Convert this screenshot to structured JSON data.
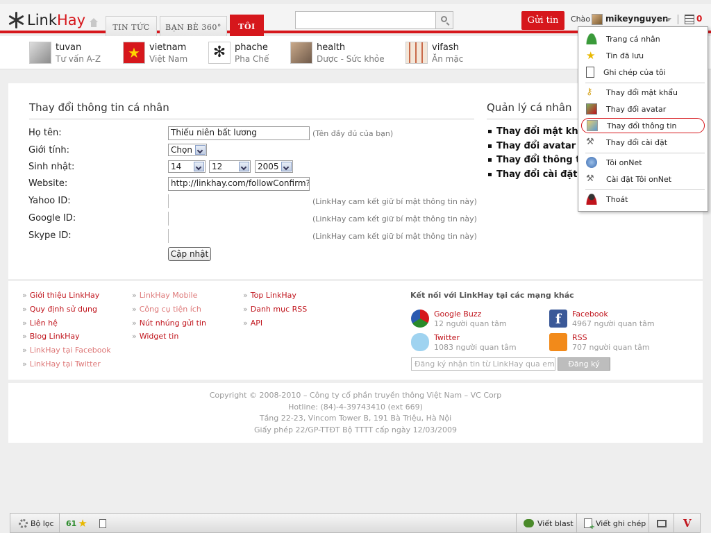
{
  "header": {
    "logo_a": "Link",
    "logo_b": "Hay",
    "tabs": [
      {
        "label": "TIN TỨC"
      },
      {
        "label": "BẠN BÈ 360°"
      },
      {
        "label": "TÔI"
      }
    ],
    "search_placeholder": "",
    "post_button": "Gửi tin",
    "greeting": "Chào",
    "username": "mikeynguyen",
    "notification_count": "0",
    "accent_color": "#d6171c"
  },
  "categories": [
    {
      "name": "tuvan",
      "sub": "Tư vấn A-Z"
    },
    {
      "name": "vietnam",
      "sub": "Việt Nam"
    },
    {
      "name": "phache",
      "sub": "Pha Chế"
    },
    {
      "name": "health",
      "sub": "Dược - Sức khỏe"
    },
    {
      "name": "vifash",
      "sub": "Ăn mặc"
    }
  ],
  "form": {
    "title": "Thay đổi thông tin cá nhân",
    "fields": {
      "name_label": "Họ tên:",
      "name_value": "Thiếu niên bất lương",
      "name_hint": "(Tên đầy đủ của bạn)",
      "gender_label": "Giới tính:",
      "gender_value": "Chọn",
      "birthday_label": "Sinh nhật:",
      "birthday_day": "14",
      "birthday_month": "12",
      "birthday_year": "2005",
      "website_label": "Website:",
      "website_value": "http://linkhay.com/followConfirm?u",
      "yahoo_label": "Yahoo ID:",
      "google_label": "Google ID:",
      "skype_label": "Skype ID:",
      "privacy_hint": "(LinkHay cam kết giữ bí mật thông tin này)"
    },
    "update_button": "Cập nhật"
  },
  "side": {
    "title": "Quản lý cá nhân",
    "links": [
      "Thay đổi mật khẩu",
      "Thay đổi avatar",
      "Thay đổi thông tin",
      "Thay đổi cài đặt"
    ]
  },
  "footer": {
    "col1": [
      "Giới thiệu LinkHay",
      "Quy định sử dụng",
      "Liên hệ",
      "Blog LinkHay",
      "LinkHay tại Facebook",
      "LinkHay tại Twitter"
    ],
    "col2": [
      "LinkHay Mobile",
      "Công cụ tiện ích",
      "Nút nhúng gửi tin",
      "Widget tin"
    ],
    "col3": [
      "Top LinkHay",
      "Danh mục RSS",
      "API"
    ],
    "connect_title": "Kết nối với LinkHay tại các mạng khác",
    "socials": [
      {
        "name": "Google Buzz",
        "count": "12 người quan tâm"
      },
      {
        "name": "Facebook",
        "count": "4967 người quan tâm"
      },
      {
        "name": "Twitter",
        "count": "1083 người quan tâm"
      },
      {
        "name": "RSS",
        "count": "707 người quan tâm"
      }
    ],
    "subscribe_placeholder": "Đăng ký nhận tin từ LinkHay qua email",
    "subscribe_button": "Đăng ký"
  },
  "copyright": [
    "Copyright © 2008-2010 – Công ty cổ phần truyền thông Việt Nam – VC Corp",
    "Hotline: (84)-4-39743410 (ext 669)",
    "Tầng 22-23, Vincom Tower B, 191 Bà Triệu, Hà Nội",
    "Giấy phép 22/GP-TTĐT Bộ TTTT cấp ngày 12/03/2009"
  ],
  "toolbar": {
    "filter": "Bộ lọc",
    "points": "61",
    "blast": "Viết blast",
    "write_note": "Viết ghi chép",
    "v": "V"
  },
  "dropdown": [
    {
      "label": "Trang cá nhân"
    },
    {
      "label": "Tin đã lưu"
    },
    {
      "label": "Ghi chép của tôi"
    },
    {
      "label": "Thay đổi mật khẩu"
    },
    {
      "label": "Thay đổi avatar"
    },
    {
      "label": "Thay đổi thông tin"
    },
    {
      "label": "Thay đổi cài đặt"
    },
    {
      "label": "Tôi onNet"
    },
    {
      "label": "Cài đặt Tôi onNet"
    },
    {
      "label": "Thoát"
    }
  ]
}
